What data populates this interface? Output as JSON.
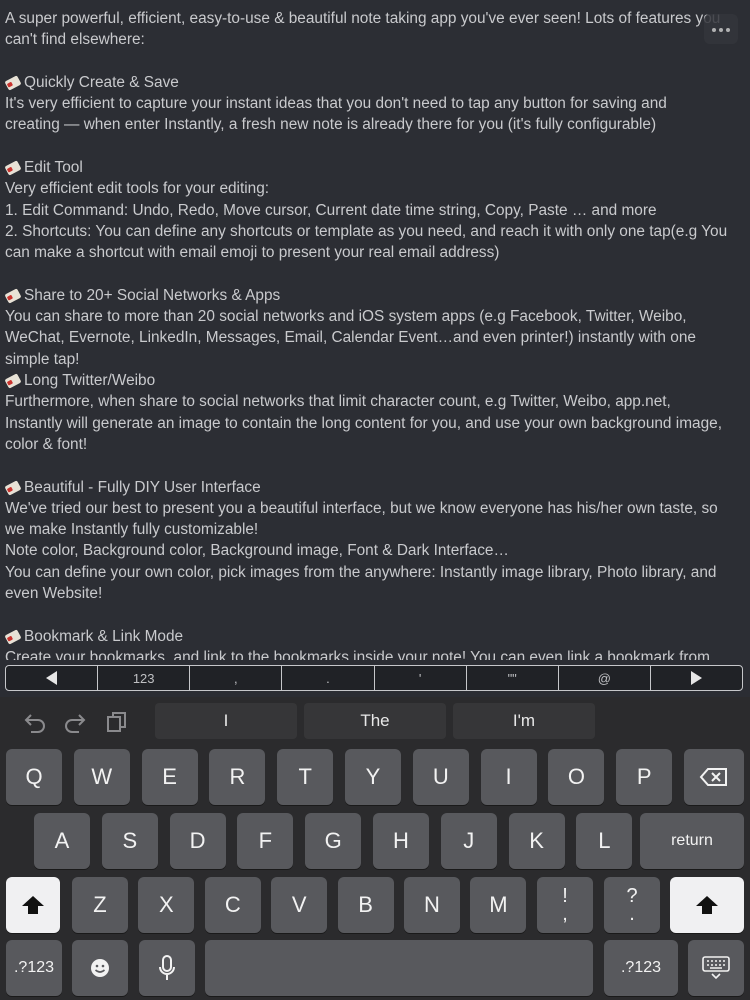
{
  "note": {
    "lines": [
      {
        "text": "A super powerful, efficient, easy-to-use & beautiful note taking app you've ever seen! Lots of features you"
      },
      {
        "text": "can't find elsewhere:"
      },
      {
        "blank": true
      },
      {
        "emoji": true,
        "text": "Quickly Create & Save"
      },
      {
        "text": "It's very efficient to capture your instant ideas that you don't need to tap any button for saving and"
      },
      {
        "text": "creating — when enter Instantly, a fresh new note is already there for you (it's fully configurable)"
      },
      {
        "blank": true
      },
      {
        "emoji": true,
        "text": "Edit Tool"
      },
      {
        "text": "Very efficient edit tools for your editing:"
      },
      {
        "text": "1. Edit Command: Undo, Redo, Move cursor, Current date time string, Copy, Paste … and more"
      },
      {
        "text": "2. Shortcuts: You can define any shortcuts or template as you need, and reach it with only one tap(e.g You"
      },
      {
        "text": "can make a shortcut with email emoji to present your real email address)"
      },
      {
        "blank": true
      },
      {
        "emoji": true,
        "text": "Share to 20+ Social Networks & Apps"
      },
      {
        "text": "You can share to more than 20 social networks and iOS system apps (e.g Facebook, Twitter, Weibo,"
      },
      {
        "text": "WeChat, Evernote, LinkedIn, Messages, Email, Calendar Event…and even printer!) instantly with one"
      },
      {
        "text": "simple tap!"
      },
      {
        "emoji": true,
        "text": "Long Twitter/Weibo"
      },
      {
        "text": "Furthermore, when share to social networks that limit character count, e.g Twitter, Weibo, app.net,"
      },
      {
        "text": "Instantly will generate an image to contain the long content for you, and use your own background image,"
      },
      {
        "text": "color & font!"
      },
      {
        "blank": true
      },
      {
        "emoji": true,
        "text": "Beautiful - Fully DIY User Interface"
      },
      {
        "text": "We've tried our best to present you a beautiful interface, but we know everyone has his/her own taste, so"
      },
      {
        "text": "we make Instantly fully customizable!"
      },
      {
        "text": "Note color, Background color, Background image, Font & Dark Interface…"
      },
      {
        "text": "You can define your own color, pick images from the anywhere: Instantly image library, Photo library, and"
      },
      {
        "text": "even Website!"
      },
      {
        "blank": true
      },
      {
        "emoji": true,
        "text": "Bookmark & Link Mode"
      },
      {
        "text": "Create your bookmarks, and link to the bookmarks inside your note! You can even link a bookmark from"
      }
    ]
  },
  "toolbar": {
    "items": [
      {
        "label": "",
        "icon": "left-arrow-icon"
      },
      {
        "label": "123"
      },
      {
        "label": ","
      },
      {
        "label": "."
      },
      {
        "label": "'"
      },
      {
        "label": "\"\""
      },
      {
        "label": "@"
      },
      {
        "label": "",
        "icon": "right-arrow-icon"
      }
    ]
  },
  "keyboard": {
    "suggestions": [
      "I",
      "The",
      "I'm"
    ],
    "row1": [
      "Q",
      "W",
      "E",
      "R",
      "T",
      "Y",
      "U",
      "I",
      "O",
      "P"
    ],
    "row2": [
      "A",
      "S",
      "D",
      "F",
      "G",
      "H",
      "J",
      "K",
      "L"
    ],
    "row3": [
      "Z",
      "X",
      "C",
      "V",
      "B",
      "N",
      "M"
    ],
    "punct1": {
      "top": "!",
      "bottom": ","
    },
    "punct2": {
      "top": "?",
      "bottom": "."
    },
    "return_label": "return",
    "numbers_label": ".?123",
    "numbers_label_right": ".?123",
    "icons": [
      "undo-icon",
      "redo-icon",
      "paste-icon",
      "backspace-icon",
      "shift-icon",
      "emoji-icon",
      "microphone-icon",
      "keyboard-dismiss-icon"
    ]
  }
}
